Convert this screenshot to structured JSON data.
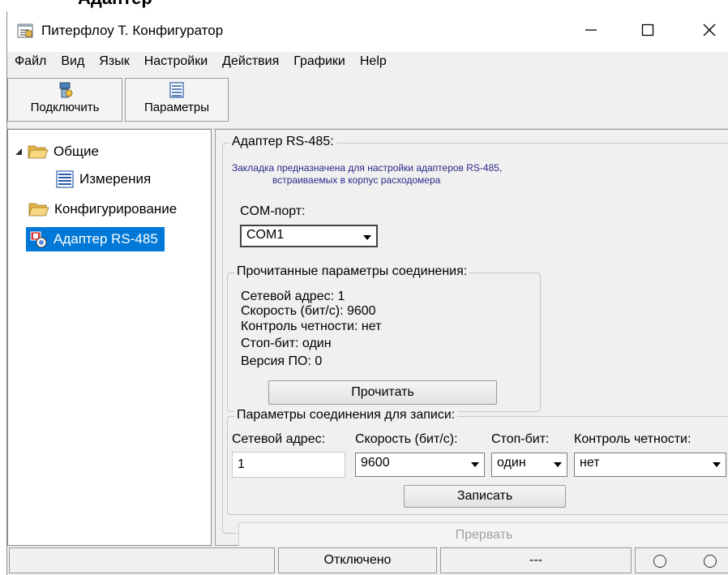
{
  "window": {
    "title": "Питерфлоу Т. Конфигуратор",
    "top_partial_title": "Адаптер"
  },
  "menu": [
    "Файл",
    "Вид",
    "Язык",
    "Настройки",
    "Действия",
    "Графики",
    "Help"
  ],
  "toolbar": {
    "connect_label": "Подключить",
    "params_label": "Параметры"
  },
  "tree": {
    "general": "Общие",
    "measure": "Измерения",
    "config": "Конфигурирование",
    "adapter": "Адаптер RS-485"
  },
  "adapter_panel": {
    "group_title": "Адаптер RS-485:",
    "description_line1": "Закладка предназначена для настройки адаптеров RS-485,",
    "description_line2": "встраиваемых в корпус расходомера",
    "com_label": "COM-порт:",
    "com_value": "COM1",
    "read_group_title": "Прочитанные параметры соединения:",
    "read_lines": [
      "Сетевой адрес: 1",
      "Скорость (бит/с): 9600",
      "Контроль четности: нет",
      "Стоп-бит: один",
      "Версия ПО: 0"
    ],
    "read_button": "Прочитать",
    "write_group_title": "Параметры соединения для записи:",
    "addr_label": "Сетевой адрес:",
    "speed_label": "Скорость (бит/с):",
    "stop_label": "Стоп-бит:",
    "parity_label": "Контроль четности:",
    "addr_value": "1",
    "speed_value": "9600",
    "stop_value": "один",
    "parity_value": "нет",
    "write_button": "Записать",
    "abort_button": "Прервать"
  },
  "status": {
    "cell1": "",
    "cell2": "Отключено",
    "cell3": "---"
  },
  "colors": {
    "selection": "#0078d7",
    "panel_bg": "#f0f0f0",
    "description_text": "#2a2a8a"
  }
}
